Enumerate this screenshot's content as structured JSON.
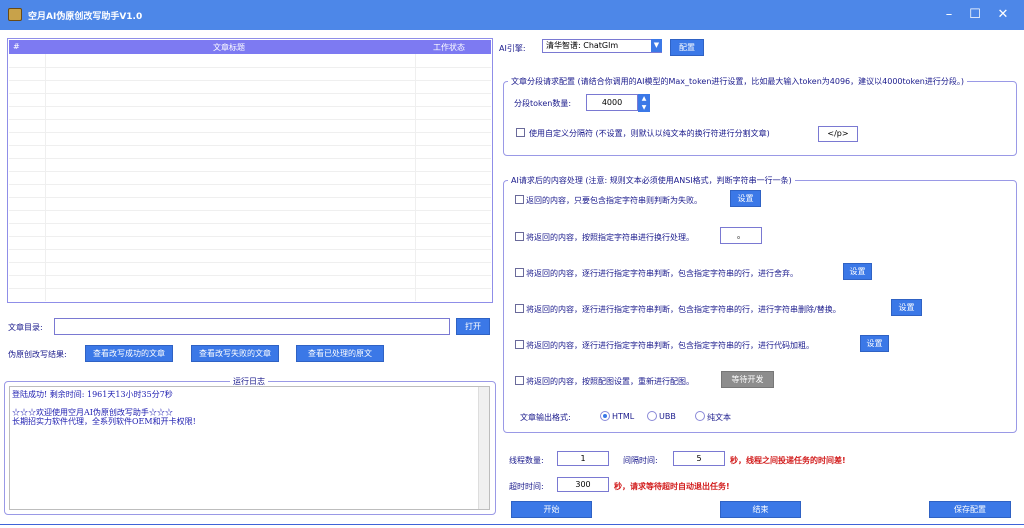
{
  "window": {
    "title": "空月AI伪原创改写助手V1.0"
  },
  "colors": {
    "titlebar": "#4d87e8",
    "button": "#3b78e7",
    "grid_header": "#7d7af2",
    "text": "#1a1a8c",
    "red": "#d21c1c"
  },
  "icons": {
    "minimize": "minimize-icon",
    "maximize": "maximize-icon",
    "close": "close-icon"
  },
  "grid": {
    "col_index": "#",
    "col_title": "文章标题",
    "col_status": "工作状态"
  },
  "article_dir": {
    "label": "文章目录:",
    "value": "",
    "open_button": "打开"
  },
  "results": {
    "label": "伪原创改写结果:",
    "btn_success": "查看改写成功的文章",
    "btn_failed": "查看改写失败的文章",
    "btn_original": "查看已处理的原文"
  },
  "log": {
    "title": "运行日志",
    "lines": [
      "登陆成功! 剩余时间: 1961天13小时35分7秒",
      "",
      "☆☆☆欢迎使用空月AI伪原创改写助手☆☆☆",
      "长期招实力软件代理，全系列软件OEM和开卡权限!"
    ]
  },
  "engine": {
    "label": "AI引擎:",
    "selected": "清华智谱: ChatGlm",
    "config_button": "配置"
  },
  "split": {
    "title": "文章分段请求配置 (请结合你调用的AI模型的Max_token进行设置，比如最大输入token为4096，建议以4000token进行分段。)",
    "token_label": "分段token数量:",
    "token_value": "4000",
    "custom_label": "使用自定义分隔符 (不设置，则默认以纯文本的换行符进行分割文章)",
    "custom_value": "</p>"
  },
  "post": {
    "title": "AI请求后的内容处理 (注意: 规则文本必须使用ANSI格式，判断字符串一行一条)",
    "opt1": "返回的内容，只要包含指定字符串则判断为失败。",
    "opt1_btn": "设置",
    "opt2": "将返回的内容，按照指定字符串进行换行处理。",
    "opt2_value": "。",
    "opt3": "将返回的内容，逐行进行指定字符串判断，包含指定字符串的行，进行舍弃。",
    "opt3_btn": "设置",
    "opt4": "将返回的内容，逐行进行指定字符串判断，包含指定字符串的行，进行字符串删除/替换。",
    "opt4_btn": "设置",
    "opt5": "将返回的内容，逐行进行指定字符串判断，包含指定字符串的行，进行代码加粗。",
    "opt5_btn": "设置",
    "opt6": "将返回的内容，按照配图设置，重新进行配图。",
    "opt6_btn": "等待开发",
    "format_label": "文章输出格式:",
    "formats": [
      "HTML",
      "UBB",
      "纯文本"
    ],
    "format_selected": "HTML"
  },
  "threads": {
    "label": "线程数量:",
    "value": "1",
    "interval_label": "间隔时间:",
    "interval_value": "5",
    "interval_hint": "秒，线程之间投递任务的时间差!",
    "timeout_label": "超时时间:",
    "timeout_value": "300",
    "timeout_hint": "秒，请求等待超时自动退出任务!"
  },
  "actions": {
    "start": "开始",
    "stop": "结束",
    "save": "保存配置"
  }
}
